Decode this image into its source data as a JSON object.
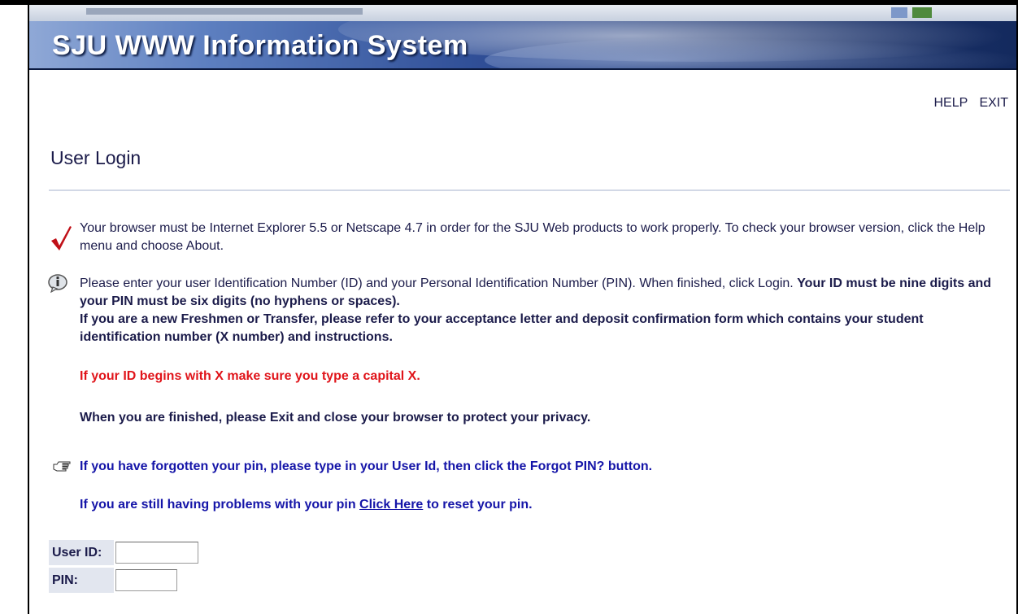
{
  "banner": {
    "title": "SJU WWW Information System"
  },
  "nav": {
    "help": "HELP",
    "exit": "EXIT"
  },
  "page": {
    "heading": "User Login"
  },
  "messages": {
    "browser_notice": "Your browser must be Internet Explorer 5.5 or Netscape 4.7 in order for the SJU Web products to work properly. To check your browser version, click the Help menu and choose About.",
    "id_instructions_plain": "Please enter your user Identification Number (ID) and your Personal Identification Number (PIN). When finished, click Login. ",
    "id_instructions_bold": "Your ID must be nine digits and your PIN must be six digits (no hyphens or spaces).",
    "freshmen_notice": "If you are a new Freshmen or Transfer, please refer to your acceptance letter and deposit confirmation form which contains your student identification number (X number) and instructions.",
    "capital_x_notice": "If your ID begins with X make sure you type a capital X.",
    "privacy_notice": "When you are finished, please Exit and close your browser to protect your privacy.",
    "forgot_pin_notice": "If you have forgotten your pin, please type in your User Id, then click the Forgot PIN? button.",
    "reset_prefix": "If you are still having problems with your pin ",
    "reset_link": "Click Here",
    "reset_suffix": " to reset your pin."
  },
  "form": {
    "user_id_label": "User ID:",
    "user_id_value": "",
    "pin_label": "PIN:",
    "pin_value": ""
  },
  "colors": {
    "banner_dark": "#142a5e",
    "banner_light": "#8fa8d6",
    "text": "#1b1b4a",
    "warning_red": "#e0141a",
    "link_blue": "#1515a8",
    "label_bg": "#e2e6ef"
  },
  "icons": {
    "browser_notice": "checkmark-icon",
    "id_instructions": "info-icon",
    "forgot_pin": "pointing-hand-icon"
  }
}
